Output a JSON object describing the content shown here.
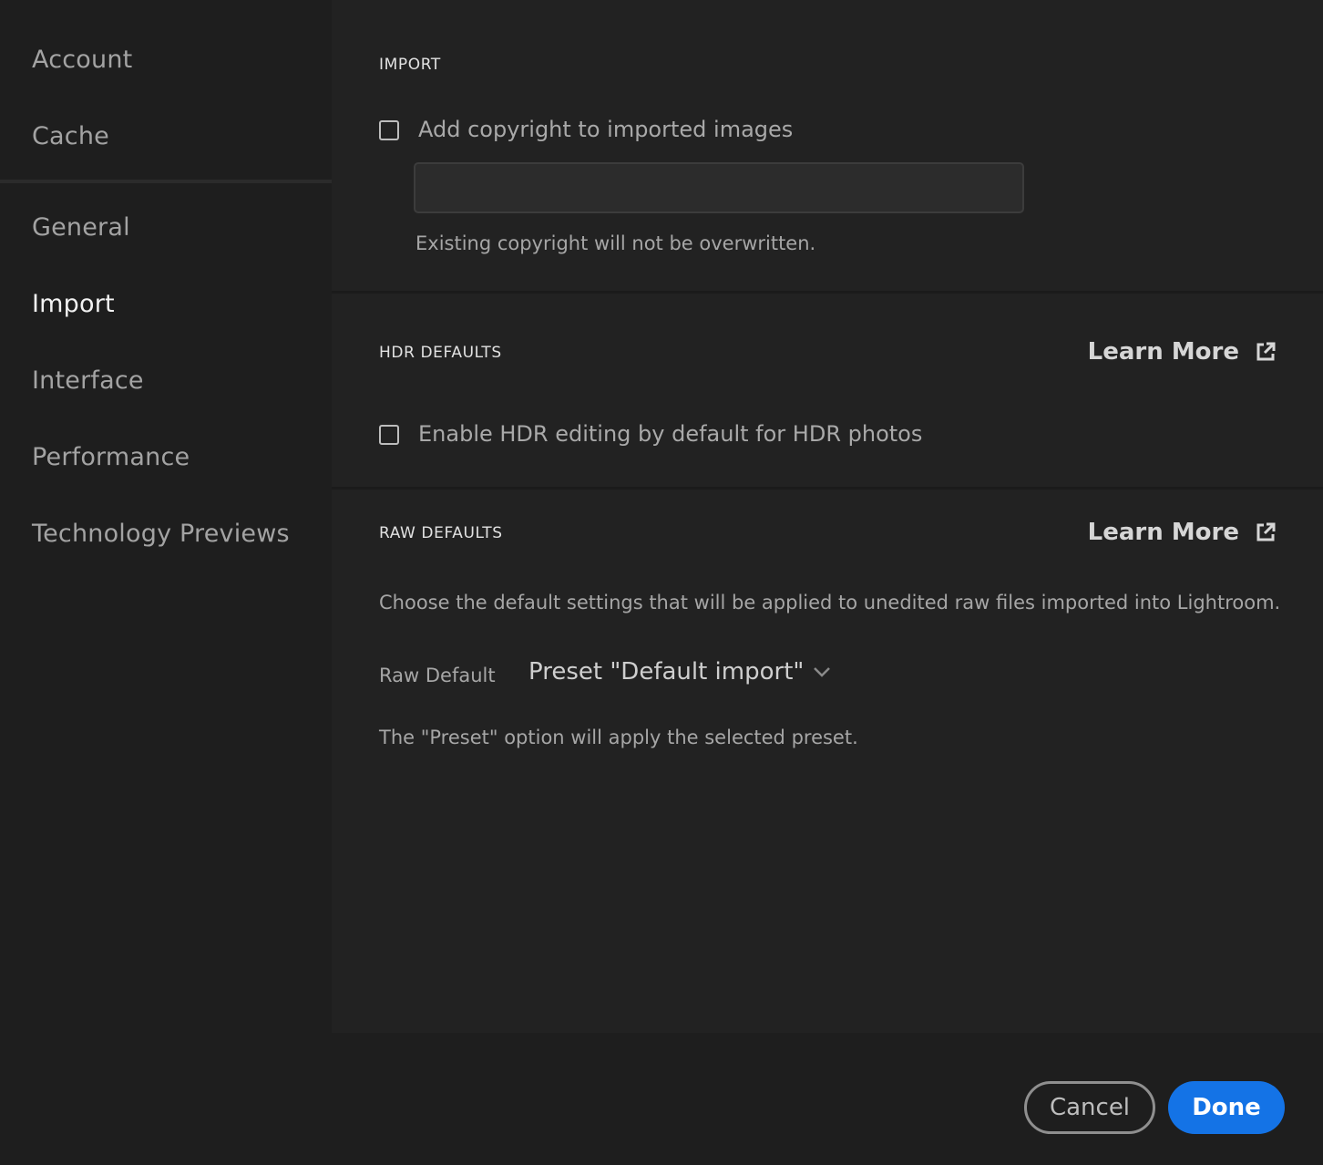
{
  "sidebar": {
    "items": [
      {
        "label": "Account"
      },
      {
        "label": "Cache"
      },
      {
        "label": "General"
      },
      {
        "label": "Import",
        "active": true
      },
      {
        "label": "Interface"
      },
      {
        "label": "Performance"
      },
      {
        "label": "Technology Previews"
      }
    ]
  },
  "import_section": {
    "title": "IMPORT",
    "copyright_checkbox_label": "Add copyright to imported images",
    "copyright_checked": false,
    "copyright_value": "",
    "copyright_hint": "Existing copyright will not be overwritten."
  },
  "hdr_section": {
    "title": "HDR DEFAULTS",
    "learn_more": "Learn More",
    "hdr_checkbox_label": "Enable HDR editing by default for HDR photos",
    "hdr_checked": false
  },
  "raw_section": {
    "title": "RAW DEFAULTS",
    "learn_more": "Learn More",
    "description": "Choose the default settings that will be applied to unedited raw files imported into Lightroom.",
    "raw_default_label": "Raw Default",
    "raw_default_value": "Preset \"Default import\"",
    "preset_hint": "The \"Preset\" option will apply the selected preset."
  },
  "footer": {
    "cancel_label": "Cancel",
    "done_label": "Done"
  },
  "colors": {
    "accent": "#1473e6",
    "background": "#1e1e1e",
    "panel": "#222222"
  }
}
